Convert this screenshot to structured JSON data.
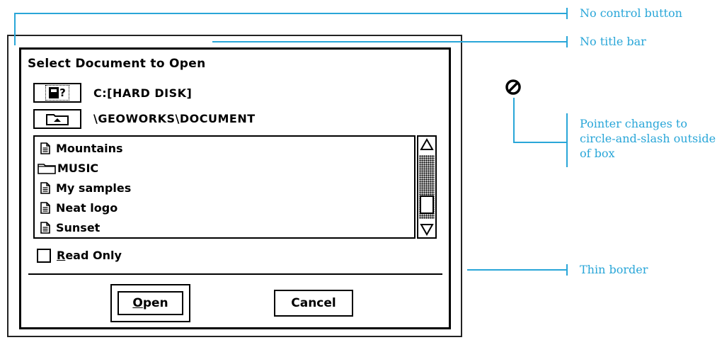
{
  "dialog": {
    "title": "Select Document to Open",
    "drive": {
      "button_text": "?",
      "label": "C:[HARD DISK]"
    },
    "path": {
      "label": "\\GEOWORKS\\DOCUMENT"
    },
    "files": [
      {
        "name": "Mountains",
        "type": "document"
      },
      {
        "name": "MUSIC",
        "type": "folder"
      },
      {
        "name": "My samples",
        "type": "document"
      },
      {
        "name": "Neat logo",
        "type": "document"
      },
      {
        "name": "Sunset",
        "type": "document"
      }
    ],
    "read_only": {
      "underlined_letter": "R",
      "rest": "ead Only",
      "checked": false
    },
    "open_button": {
      "underlined_letter": "O",
      "rest": "pen"
    },
    "cancel_button": "Cancel"
  },
  "annotations": {
    "no_control_button": "No control button",
    "no_title_bar": "No title bar",
    "pointer_note": [
      "Pointer changes to",
      "circle-and-slash outside",
      "of box"
    ],
    "thin_border": "Thin border"
  },
  "colors": {
    "annotation": "#29a6d8",
    "dialog_border": "#000000",
    "background": "#ffffff"
  },
  "icons": {
    "pointer": "circle-slash-icon",
    "document": "document-icon",
    "folder": "folder-icon",
    "scroll_up": "arrow-up-icon",
    "scroll_down": "arrow-down-icon"
  }
}
